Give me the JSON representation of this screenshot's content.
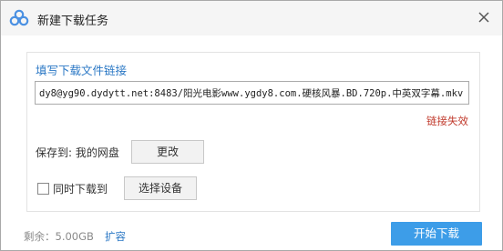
{
  "window": {
    "title": "新建下载任务"
  },
  "form": {
    "link_label": "填写下载文件链接",
    "url_value": "dy8@yg90.dydytt.net:8483/阳光电影www.ygdy8.com.硬核风暴.BD.720p.中英双字幕.mkv",
    "link_status": "链接失效",
    "save_label": "保存到: 我的网盘",
    "change_button": "更改",
    "sync_checkbox_label": "同时下载到",
    "sync_checked": false,
    "select_device_button": "选择设备"
  },
  "footer": {
    "remaining": "剩余：5.00GB",
    "expand_link": "扩容",
    "start_button": "开始下载"
  },
  "colors": {
    "accent": "#3d9de8",
    "link": "#2b78c5",
    "error": "#c0392b",
    "logo": "#4a90e2"
  },
  "icons": {
    "logo": "cloud-logo-icon",
    "close": "close-icon"
  }
}
